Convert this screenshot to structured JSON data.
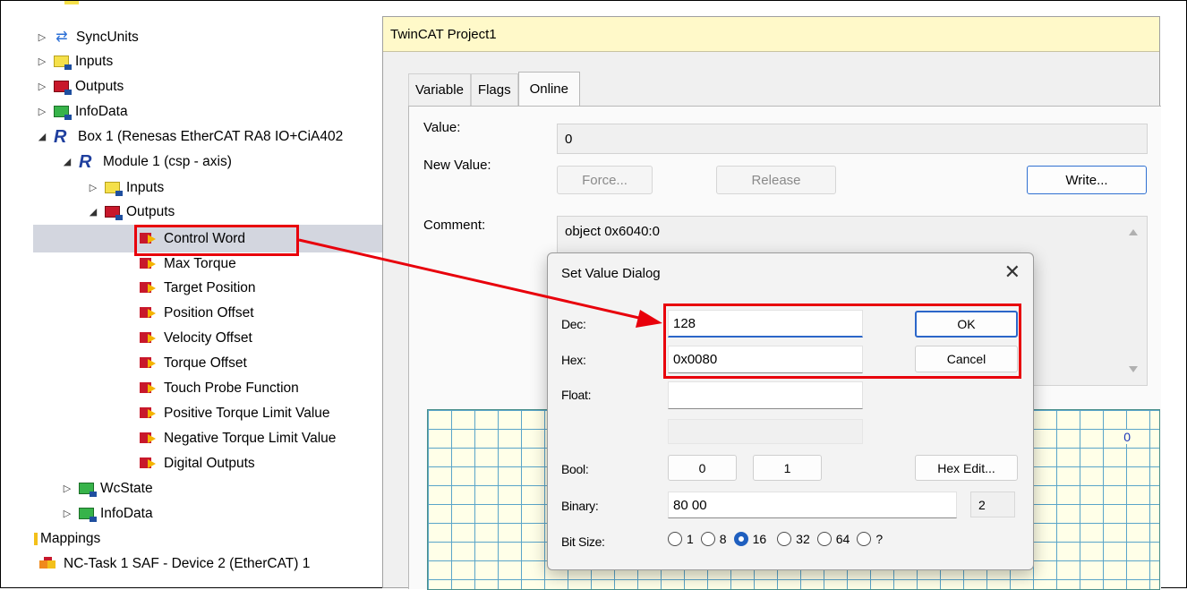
{
  "tree": {
    "rows": [
      {
        "label": "SyncUnits",
        "icon": "sync-icon",
        "arrow": "▷"
      },
      {
        "label": "Inputs",
        "icon": "input-folder-icon",
        "arrow": "▷"
      },
      {
        "label": "Outputs",
        "icon": "output-folder-icon",
        "arrow": "▷"
      },
      {
        "label": "InfoData",
        "icon": "infodata-folder-icon",
        "arrow": "▷"
      },
      {
        "label": "Box 1 (Renesas EtherCAT RA8 IO+CiA402",
        "icon": "box-device-icon",
        "arrow": "◢"
      },
      {
        "label": "Module 1 (csp - axis)",
        "icon": "module-icon",
        "arrow": "◢"
      },
      {
        "label": "Inputs",
        "icon": "input-folder-icon",
        "arrow": "▷"
      },
      {
        "label": "Outputs",
        "icon": "output-folder-icon",
        "arrow": "◢"
      },
      {
        "label": "Control Word",
        "icon": "output-variable-icon"
      },
      {
        "label": "Max Torque",
        "icon": "output-variable-icon"
      },
      {
        "label": "Target Position",
        "icon": "output-variable-icon"
      },
      {
        "label": "Position Offset",
        "icon": "output-variable-icon"
      },
      {
        "label": "Velocity Offset",
        "icon": "output-variable-icon"
      },
      {
        "label": "Torque Offset",
        "icon": "output-variable-icon"
      },
      {
        "label": "Touch Probe Function",
        "icon": "output-variable-icon"
      },
      {
        "label": "Positive Torque Limit Value",
        "icon": "output-variable-icon"
      },
      {
        "label": "Negative Torque Limit Value",
        "icon": "output-variable-icon"
      },
      {
        "label": "Digital Outputs",
        "icon": "output-variable-icon"
      },
      {
        "label": "WcState",
        "icon": "wcstate-folder-icon",
        "arrow": "▷"
      },
      {
        "label": "InfoData",
        "icon": "infodata-folder-icon",
        "arrow": "▷"
      },
      {
        "label": "Mappings",
        "icon": "mappings-icon"
      },
      {
        "label": "NC-Task 1 SAF - Device 2 (EtherCAT) 1",
        "icon": "nc-task-icon"
      }
    ]
  },
  "window": {
    "title": "TwinCAT Project1",
    "tabs": [
      "Variable",
      "Flags",
      "Online"
    ],
    "value_label": "Value:",
    "value": "0",
    "new_value_label": "New Value:",
    "force_label": "Force...",
    "release_label": "Release",
    "write_label": "Write...",
    "comment_label": "Comment:",
    "comment": "object 0x6040:0",
    "chart_value": "0"
  },
  "dialog": {
    "title": "Set Value Dialog",
    "close": "✕",
    "dec_label": "Dec:",
    "dec_value": "128",
    "hex_label": "Hex:",
    "hex_value": "0x0080",
    "float_label": "Float:",
    "float_value": "",
    "ok_label": "OK",
    "cancel_label": "Cancel",
    "bool_label": "Bool:",
    "bool_0": "0",
    "bool_1": "1",
    "hex_edit_label": "Hex Edit...",
    "binary_label": "Binary:",
    "binary_value": "80 00",
    "binary_count": "2",
    "bitsize_label": "Bit Size:",
    "bitsizes": [
      "1",
      "8",
      "16",
      "32",
      "64",
      "?"
    ],
    "bitsize_selected": "16"
  },
  "colors": {
    "annotation": "#e8000b",
    "title_bar": "#fff9c9",
    "selection": "#d3d6df"
  }
}
